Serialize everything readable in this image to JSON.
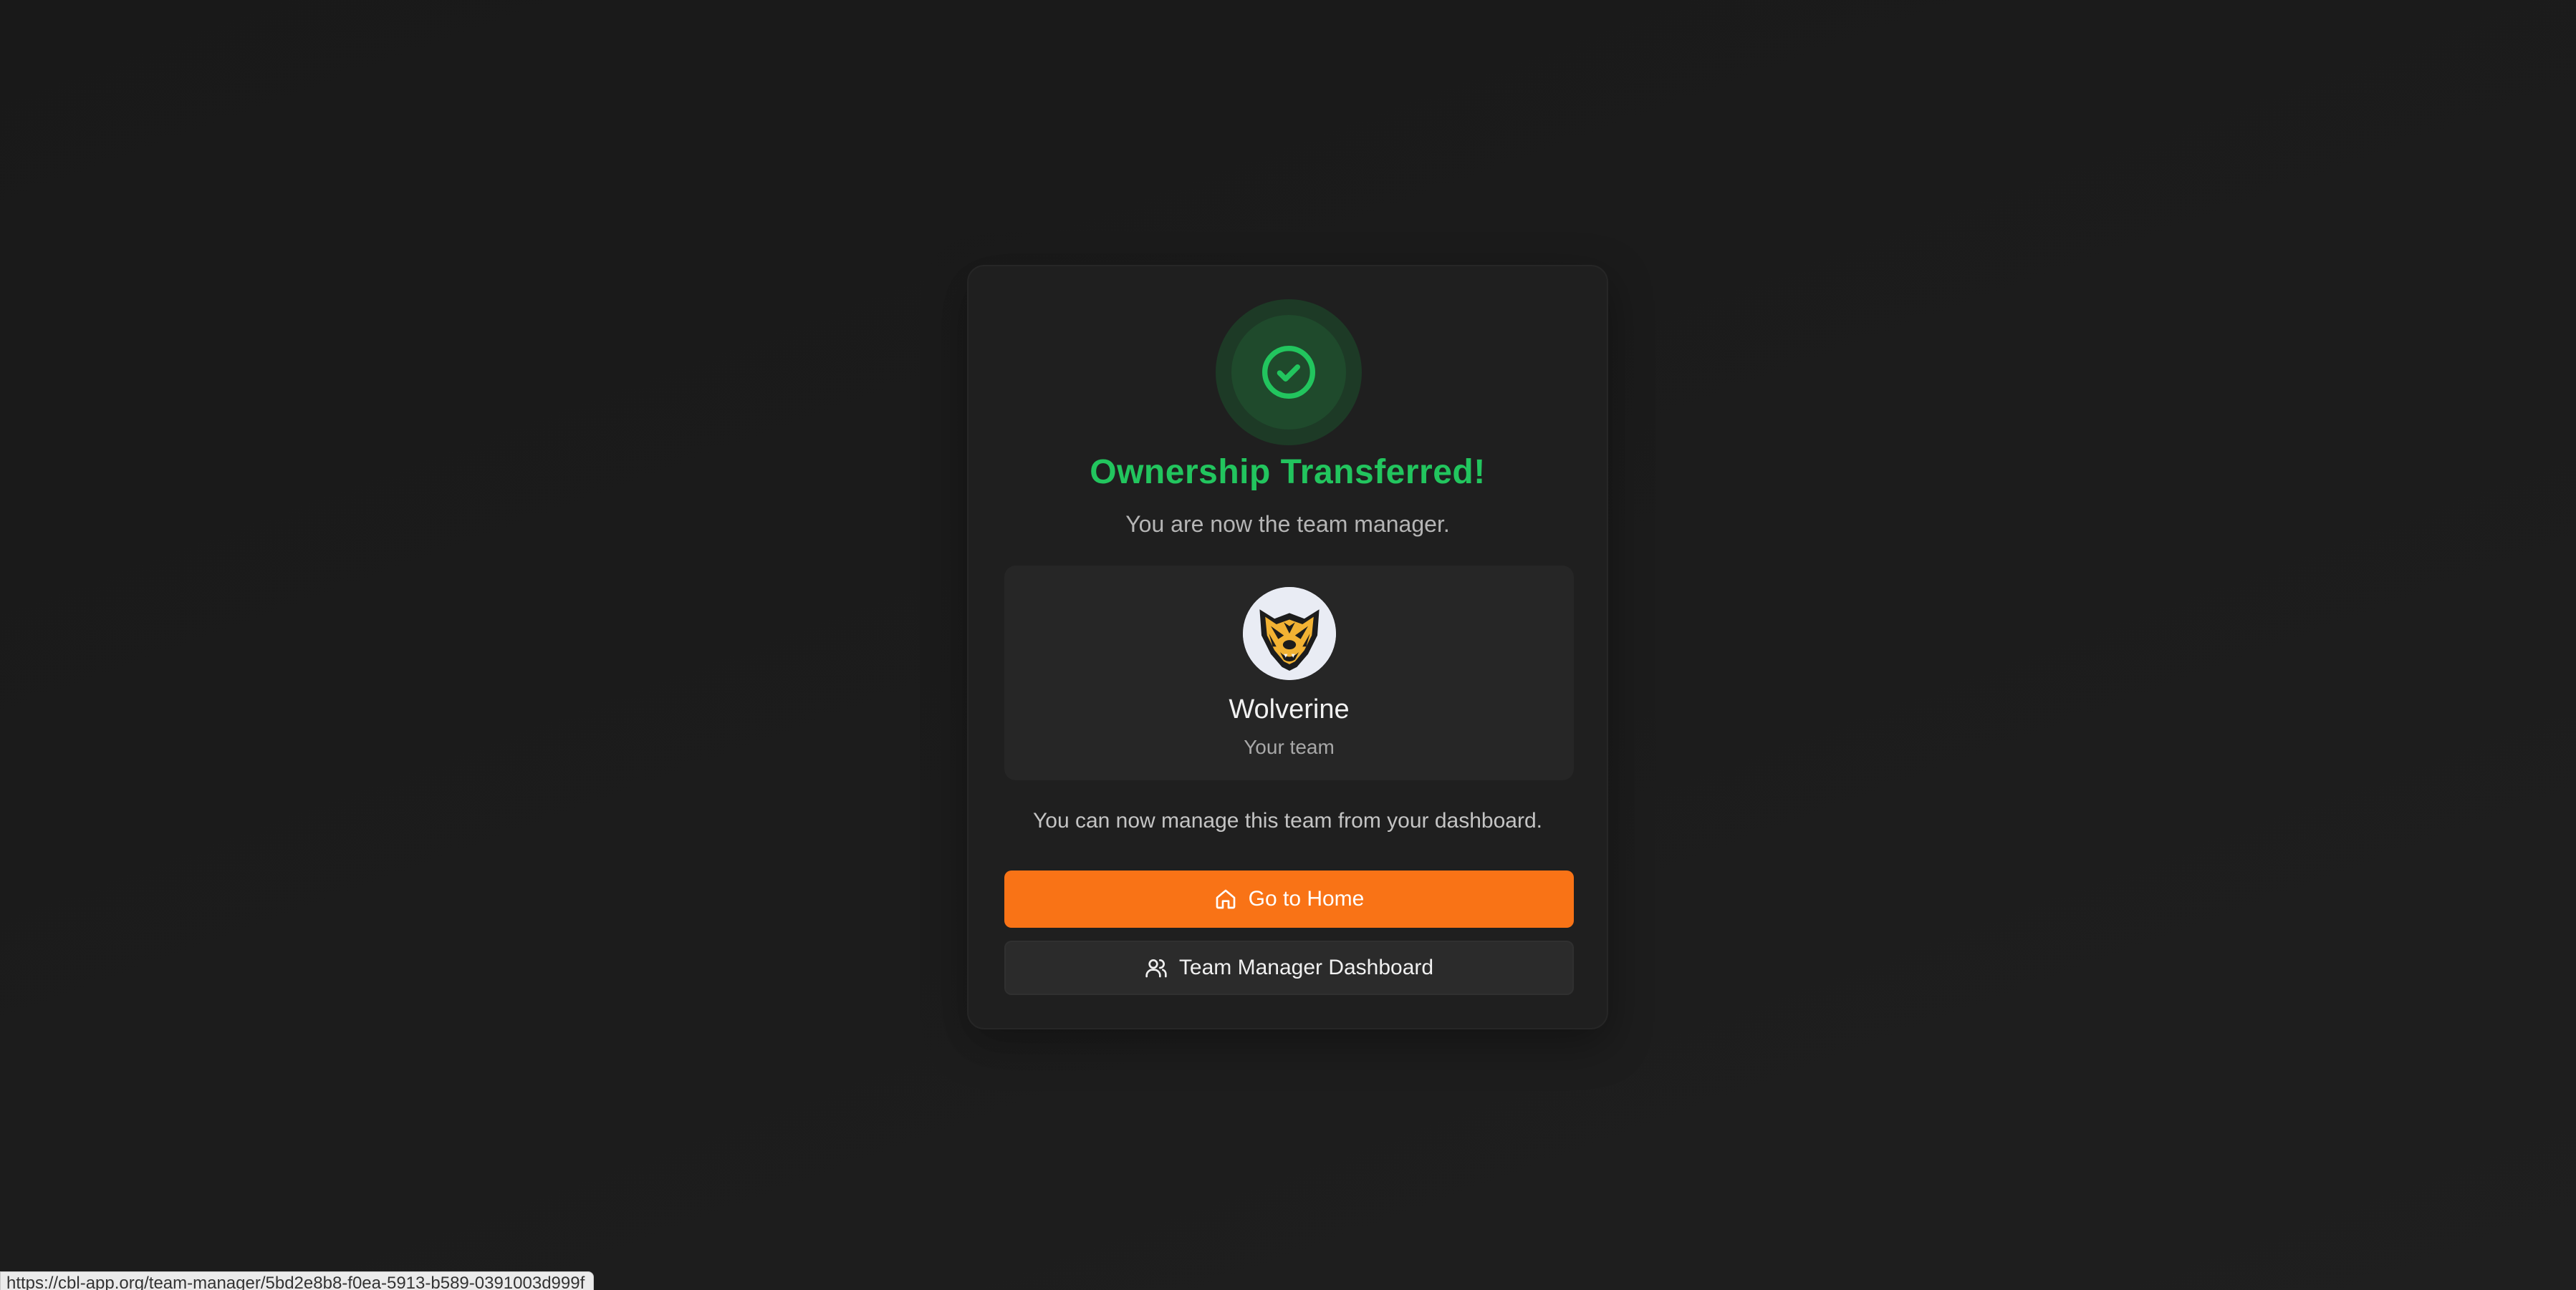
{
  "card": {
    "title": "Ownership Transferred!",
    "subtitle": "You are now the team manager.",
    "success_icon": "check-circle-icon"
  },
  "team": {
    "name": "Wolverine",
    "label": "Your team",
    "avatar_icon": "wolverine-logo"
  },
  "message": "You can now manage this team from your dashboard.",
  "buttons": {
    "home": {
      "label": "Go to Home",
      "icon": "home-icon"
    },
    "dashboard": {
      "label": "Team Manager Dashboard",
      "icon": "users-icon"
    }
  },
  "status_bar": {
    "url": "https://cbl-app.org/team-manager/5bd2e8b8-f0ea-5913-b589-0391003d999f"
  },
  "colors": {
    "success": "#22c55e",
    "primary": "#f97316",
    "background": "#1a1a1a"
  }
}
